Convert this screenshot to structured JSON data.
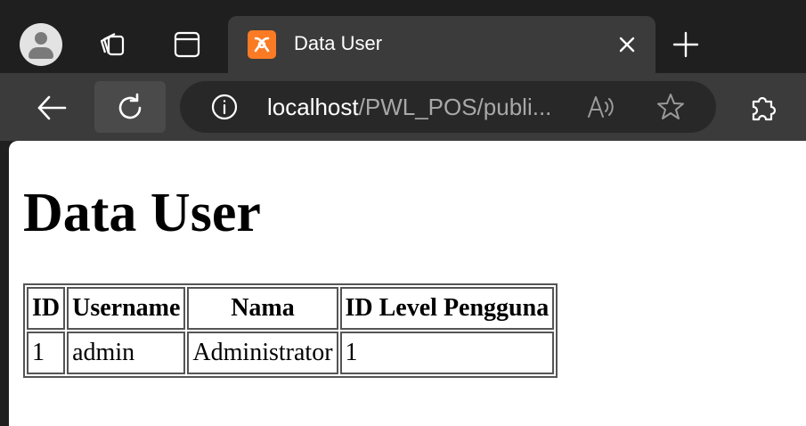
{
  "browser": {
    "tab": {
      "title": "Data User",
      "favicon": "xampp-icon"
    },
    "address_bar": {
      "host": "localhost",
      "path": "/PWL_POS/publi..."
    },
    "icons": {
      "profile": "profile-icon",
      "workspaces": "workspaces-icon",
      "tab_actions": "tab-actions-icon",
      "close": "close-icon",
      "new_tab": "plus-icon",
      "back": "back-arrow-icon",
      "reload": "reload-icon",
      "site_info": "info-icon",
      "read_aloud": "read-aloud-icon",
      "favorite": "star-icon",
      "extensions": "puzzle-icon"
    },
    "colors": {
      "tabstrip_bg": "#1f1f1f",
      "toolbar_bg": "#3b3b3b",
      "omnibox_bg": "#282828",
      "favicon": "#fb7a24"
    }
  },
  "page": {
    "heading": "Data User",
    "table": {
      "headers": [
        "ID",
        "Username",
        "Nama",
        "ID Level Pengguna"
      ],
      "rows": [
        [
          "1",
          "admin",
          "Administrator",
          "1"
        ]
      ]
    }
  }
}
